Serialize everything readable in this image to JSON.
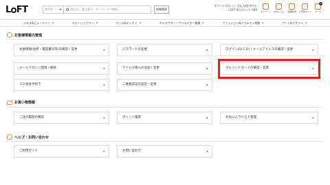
{
  "header": {
    "logo": "LOFT",
    "search": {
      "category": "すべて",
      "placeholder": "製品名・製品番号・キーワードで検索",
      "detail_label": "詳細検索"
    },
    "user_line1": "ポイント付与 ○○ さん",
    "logout": "ログアウト",
    "user_line2": "LOFT ID ポイント 500",
    "icons": [
      {
        "label": "マイページ",
        "icon": "person-icon"
      },
      {
        "label": "お気に入り",
        "icon": "heart-icon"
      },
      {
        "label": "店舗情報",
        "icon": "store-icon"
      },
      {
        "label": "ご利用ガイド",
        "icon": "guide-icon"
      },
      {
        "label": "カート",
        "icon": "cart-icon"
      }
    ],
    "cart_count": "0"
  },
  "nav": [
    "コスメ&ビューティー",
    "ステーショナリー",
    "ホーム&キッチン",
    "キャラクター・クリエイター雑貨",
    "ファッション&バラエティ雑貨",
    "アート&デザイン"
  ],
  "sections": {
    "account": {
      "title": "お客様情報の管理",
      "items": [
        "会員情報(住所・電話番号等)の確認・変更",
        "パスワードの変更",
        "ログインID(ＩＤ)・メールアドレスの確認・変更",
        "メールマガジン登録・解除",
        "アドレス帳への追加・変更",
        "クレジットカードの確認・変更",
        "ＩＤ退会手続き",
        "二要素認証の設定・変更"
      ]
    },
    "shopping": {
      "title": "お買い物情報",
      "items": [
        "ご注文履歴の確認",
        "ポイント履歴",
        "お気に入りリスト管理"
      ]
    },
    "help": {
      "title": "ヘルプ・お問い合わせ",
      "items": [
        "ご利用ガイド",
        "お問い合わせ"
      ]
    }
  },
  "colors": {
    "accent": "#e09a3a",
    "highlight": "#e02020"
  }
}
